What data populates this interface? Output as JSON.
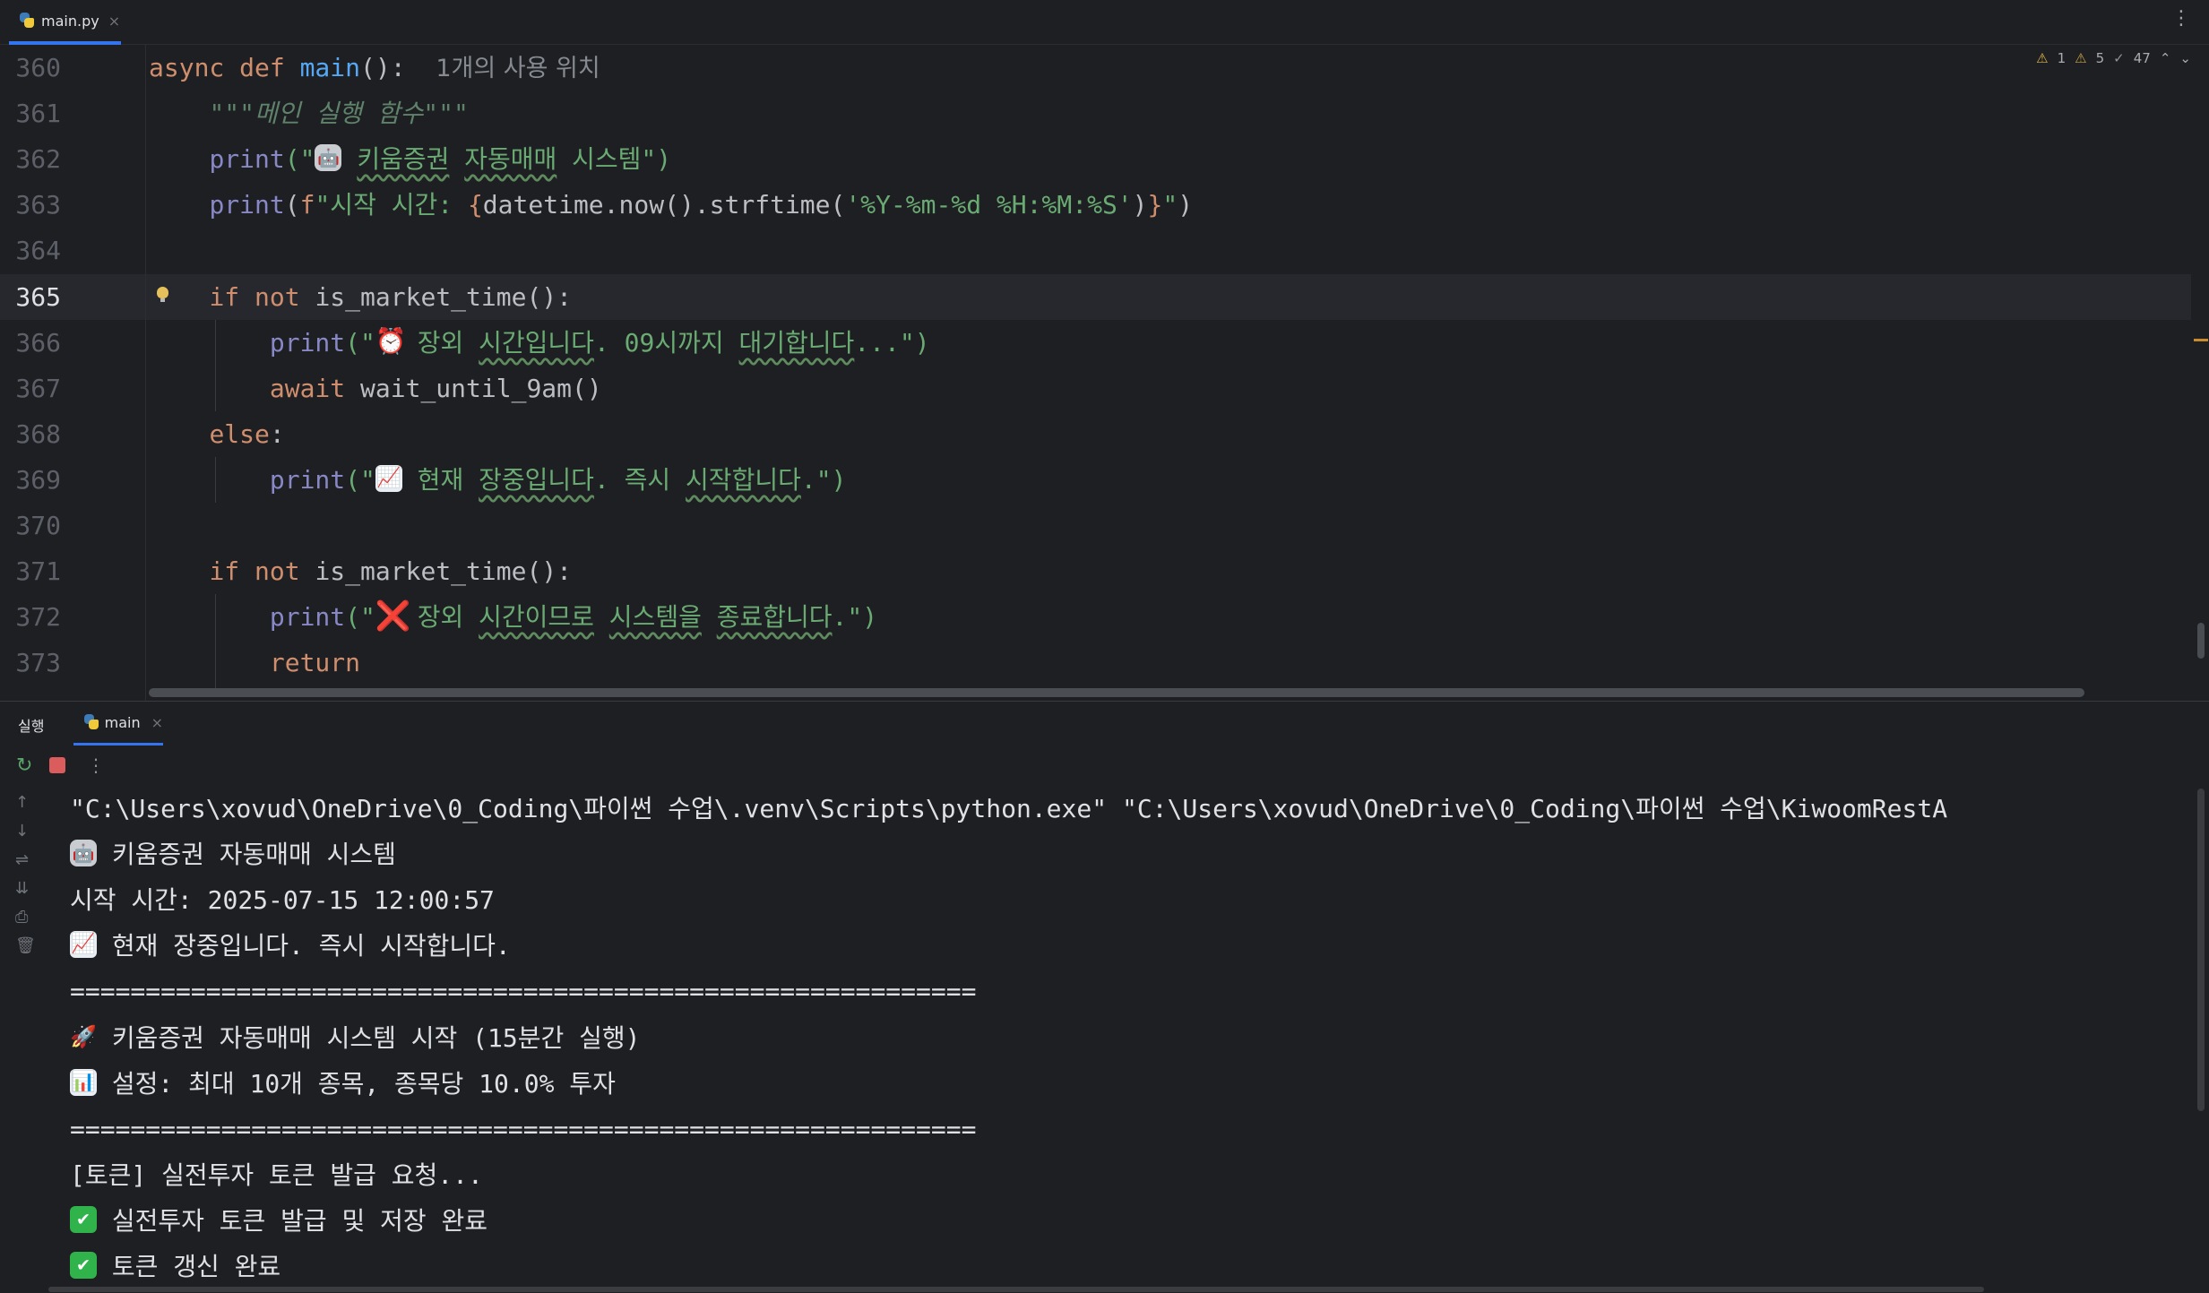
{
  "editor": {
    "tab": {
      "filename": "main.py",
      "close": "×"
    },
    "more_icon": "⋮",
    "inspections": {
      "warnings": "1",
      "weak_warnings": "5",
      "typos": "47"
    },
    "line_numbers": [
      "360",
      "361",
      "362",
      "363",
      "364",
      "365",
      "366",
      "367",
      "368",
      "369",
      "370",
      "371",
      "372",
      "373"
    ],
    "lines": {
      "l360": {
        "kw": "async def ",
        "fn": "main",
        "rest": "():",
        "hint": "1개의 사용 위치"
      },
      "l361": {
        "doc": "\"\"\"메인 실행 함수\"\"\""
      },
      "l362": {
        "bi": "print",
        "open": "(\"",
        "emoji": "🤖",
        "s1": "키움증권",
        "s2": "자동매매",
        "s3": "시스템",
        "close": "\")"
      },
      "l363": {
        "bi": "print",
        "open": "(",
        "kw": "f",
        "str1": "\"시작 시간: ",
        "brace1": "{",
        "expr": "datetime.now().strftime(",
        "str2": "'%Y-%m-%d %H:%M:%S'",
        "expr2": ")",
        "brace2": "}",
        "str3": "\"",
        "close": ")"
      },
      "l365": {
        "kw": "if not ",
        "rest": "is_market_time():"
      },
      "l366": {
        "bi": "print",
        "open": "(\"",
        "emoji": "⏰",
        "s1": "장외",
        "s2": "시간입니다",
        "s3": ". 09시까지",
        "s4": "대기합니다",
        "s5": "...",
        "close": "\")"
      },
      "l367": {
        "kw": "await ",
        "rest": "wait_until_9am()"
      },
      "l368": {
        "kw": "else",
        "rest": ":"
      },
      "l369": {
        "bi": "print",
        "open": "(\"",
        "emoji": "📈",
        "s1": "현재",
        "s2": "장중입니다",
        "s3": ". 즉시",
        "s4": "시작합니다",
        "s5": ".",
        "close": "\")"
      },
      "l371": {
        "kw": "if not ",
        "rest": "is_market_time():"
      },
      "l372": {
        "bi": "print",
        "open": "(\"",
        "emoji": "❌",
        "s1": "장외",
        "s2": "시간이므로",
        "s3": "시스템을",
        "s4": "종료합니다",
        "s5": ".",
        "close": "\")"
      },
      "l373": {
        "kw": "return"
      }
    }
  },
  "run": {
    "title": "실행",
    "tab": {
      "label": "main",
      "close": "×"
    },
    "console": [
      {
        "emoji": "",
        "text": "\"C:\\Users\\xovud\\OneDrive\\0_Coding\\파이썬 수업\\.venv\\Scripts\\python.exe\" \"C:\\Users\\xovud\\OneDrive\\0_Coding\\파이썬 수업\\KiwoomRestA"
      },
      {
        "emoji": "🤖",
        "text": "키움증권 자동매매 시스템"
      },
      {
        "emoji": "",
        "text": "시작 시간: 2025-07-15 12:00:57"
      },
      {
        "emoji": "📈",
        "text": "현재 장중입니다. 즉시 시작합니다."
      },
      {
        "emoji": "",
        "text": "============================================================"
      },
      {
        "emoji": "🚀",
        "text": "키움증권 자동매매 시스템 시작 (15분간 실행)"
      },
      {
        "emoji": "📊",
        "text": "설정: 최대 10개 종목, 종목당 10.0% 투자"
      },
      {
        "emoji": "",
        "text": "============================================================"
      },
      {
        "emoji": "",
        "text": "[토큰] 실전투자 토큰 발급 요청..."
      },
      {
        "emoji": "✔",
        "text": "실전투자 토큰 발급 및 저장 완료"
      },
      {
        "emoji": "✔",
        "text": "토큰 갱신 완료"
      }
    ]
  },
  "icons": {
    "rerun": "↻",
    "more": "⋮",
    "up": "↑",
    "down": "↓",
    "wrap": "⇌",
    "scroll_end": "⇊",
    "print": "⎙",
    "trash": "🗑"
  },
  "colors": {
    "accent": "#3574f0",
    "keyword": "#cf8e6d",
    "function": "#56a8f5",
    "string": "#6aab73",
    "builtin": "#8888c6",
    "stop": "#db5c5c"
  }
}
